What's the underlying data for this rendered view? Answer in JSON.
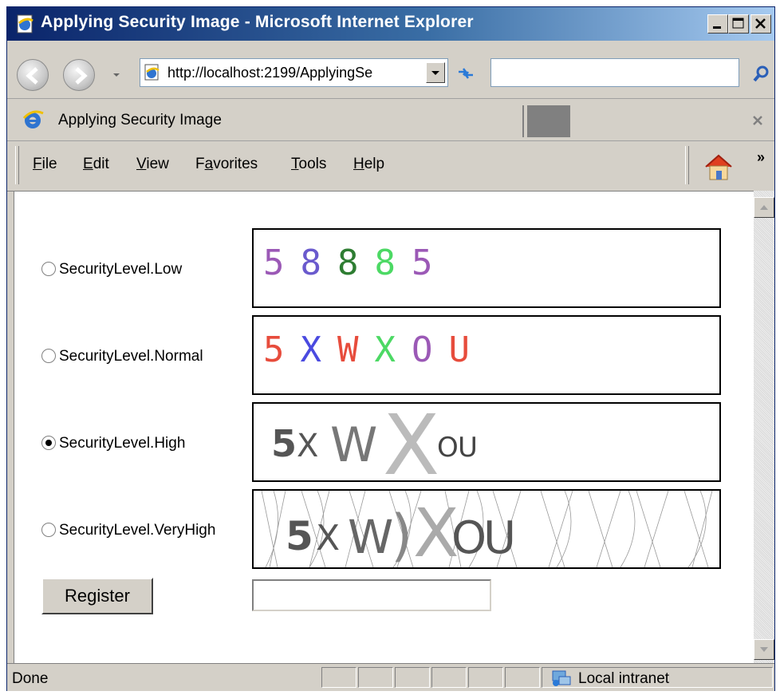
{
  "window": {
    "title": "Applying Security Image - Microsoft Internet Explorer",
    "icon": "ie-page-icon",
    "controls": {
      "minimize_icon": "minimize-icon",
      "maximize_icon": "maximize-icon",
      "close_icon": "close-icon"
    }
  },
  "address_bar": {
    "back_icon": "back-arrow-icon",
    "forward_icon": "forward-arrow-icon",
    "url": "http://localhost:2199/ApplyingSe",
    "search_value": ""
  },
  "tab": {
    "title": "Applying Security Image"
  },
  "menu": {
    "items": [
      {
        "label": "File",
        "access_key": "F"
      },
      {
        "label": "Edit",
        "access_key": "E"
      },
      {
        "label": "View",
        "access_key": "V"
      },
      {
        "label": "Favorites",
        "access_key": "a"
      },
      {
        "label": "Tools",
        "access_key": "T"
      },
      {
        "label": "Help",
        "access_key": "H"
      }
    ],
    "more": "»"
  },
  "form": {
    "options": [
      {
        "label": "SecurityLevel.Low",
        "checked": false,
        "captcha": [
          {
            "char": "5",
            "color": "#9b59b6"
          },
          {
            "char": "8",
            "color": "#6a5acd"
          },
          {
            "char": "8",
            "color": "#2e7d32"
          },
          {
            "char": "8",
            "color": "#4cd964"
          },
          {
            "char": "5",
            "color": "#9b59b6"
          }
        ]
      },
      {
        "label": "SecurityLevel.Normal",
        "checked": false,
        "captcha": [
          {
            "char": "5",
            "color": "#e74c3c"
          },
          {
            "char": "X",
            "color": "#4a4ae0"
          },
          {
            "char": "W",
            "color": "#e74c3c"
          },
          {
            "char": "X",
            "color": "#4cd964"
          },
          {
            "char": "O",
            "color": "#9b59b6"
          },
          {
            "char": "U",
            "color": "#e74c3c"
          }
        ]
      },
      {
        "label": "SecurityLevel.High",
        "checked": true,
        "captcha_text": "5XWXOU"
      },
      {
        "label": "SecurityLevel.VeryHigh",
        "checked": false,
        "captcha_text": "5XWXOU"
      }
    ],
    "register_label": "Register",
    "captcha_input_value": ""
  },
  "status": {
    "text": "Done",
    "zone": "Local intranet",
    "zone_icon": "local-intranet-icon"
  }
}
